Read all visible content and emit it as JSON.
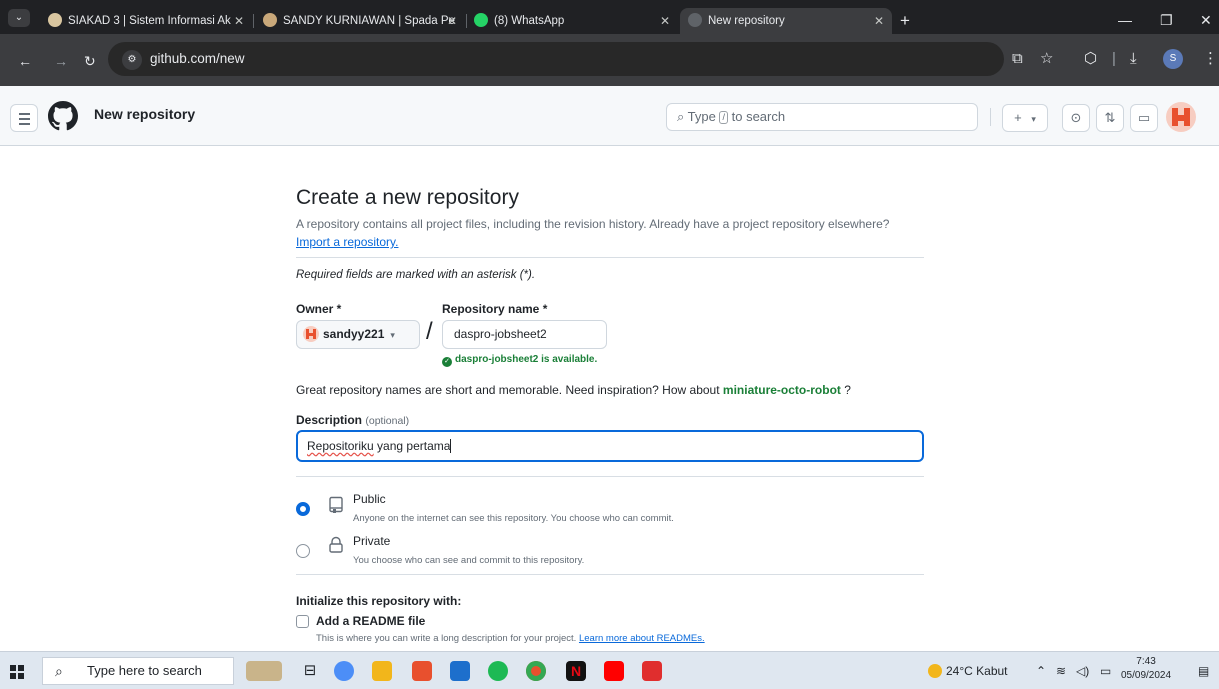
{
  "browser": {
    "tabs": [
      {
        "label": "SIAKAD 3 | Sistem Informasi Ak",
        "active": false
      },
      {
        "label": "SANDY KURNIAWAN | Spada Pe",
        "active": false
      },
      {
        "label": "(8) WhatsApp",
        "active": false
      },
      {
        "label": "New repository",
        "active": true
      }
    ],
    "url": "github.com/new"
  },
  "github": {
    "header_title": "New repository",
    "search_prefix": "Type",
    "search_kbd": "/",
    "search_suffix": "to search",
    "plus_label": "+",
    "caret": "▾"
  },
  "form": {
    "title": "Create a new repository",
    "description": "A repository contains all project files, including the revision history. Already have a project repository elsewhere?",
    "import_link": "Import a repository.",
    "required_note": "Required fields are marked with an asterisk (*).",
    "owner_label": "Owner *",
    "owner_value": "sandyy221",
    "repo_label": "Repository name *",
    "repo_value": "daspro-jobsheet2",
    "availability": "daspro-jobsheet2 is available.",
    "inspiration_text": "Great repository names are short and memorable. Need inspiration? How about",
    "suggestion": "miniature-octo-robot",
    "inspiration_end": "?",
    "description_label": "Description",
    "optional": "(optional)",
    "description_word1": "Repositoriku",
    "description_rest": " yang pertama",
    "visibility": [
      {
        "title": "Public",
        "desc": "Anyone on the internet can see this repository. You choose who can commit.",
        "selected": true
      },
      {
        "title": "Private",
        "desc": "You choose who can see and commit to this repository.",
        "selected": false
      }
    ],
    "init_label": "Initialize this repository with:",
    "readme_label": "Add a README file",
    "readme_desc": "This is where you can write a long description for your project.",
    "readme_link": "Learn more about READMEs."
  },
  "taskbar": {
    "search_placeholder": "Type here to search",
    "weather": "24°C  Kabut",
    "time": "7:43",
    "date": "05/09/2024"
  },
  "colors": {
    "link": "#0969da",
    "success": "#1a7f37",
    "tabstrip": "#202124"
  }
}
